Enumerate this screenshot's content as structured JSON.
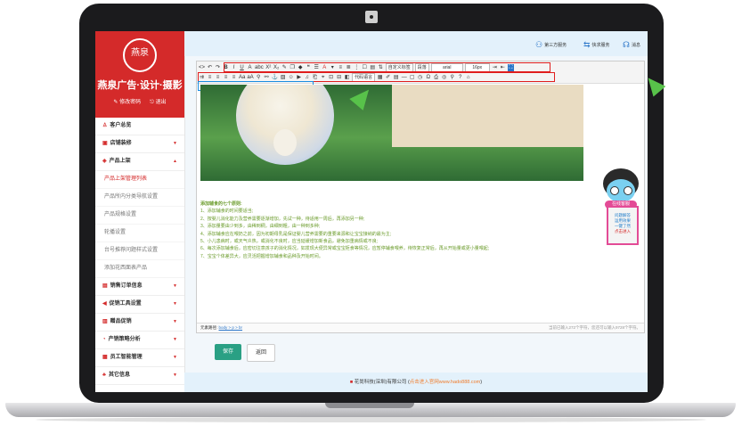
{
  "sidebar": {
    "logo": "燕泉",
    "brand": "燕泉广告·设计·摄影",
    "links": {
      "edit_password": "修改密码",
      "logout": "退出"
    },
    "sections": [
      {
        "label": "客户总览",
        "icon": "user-icon"
      },
      {
        "label": "店铺装修",
        "icon": "shop-icon"
      },
      {
        "label": "产品上架",
        "icon": "product-icon"
      }
    ],
    "product_subs": [
      "产品上架管理列表",
      "产品所内分类导航设置",
      "产品规格设置",
      "轮播设置",
      "台号推荐问题样式设置",
      "添加花西面表产品"
    ],
    "more_sections": [
      {
        "label": "销售订单信息",
        "icon": "order-icon"
      },
      {
        "label": "促销工具设置",
        "icon": "promo-icon"
      },
      {
        "label": "赠品促销",
        "icon": "gift-icon"
      },
      {
        "label": "产销策略分析",
        "icon": "analysis-icon"
      },
      {
        "label": "员工智能管理",
        "icon": "staff-icon"
      },
      {
        "label": "其它信息",
        "icon": "other-icon"
      }
    ]
  },
  "topbar": {
    "third_party": "第三方服务",
    "quick_actions": "快求服务",
    "messages": "消息"
  },
  "editor": {
    "toolbar_row1": [
      "B",
      "I",
      "U",
      "A",
      "abc",
      "X²",
      "X₂",
      "✎",
      "❐",
      "◆",
      "❝",
      "☰",
      "A",
      "▾",
      "≡",
      "≣",
      "⋮",
      "☐",
      "▤",
      "⇅",
      "⌘"
    ],
    "font_family_select": "自定义标签",
    "paragraph_select": "段落",
    "font_select": "arial",
    "size_select": "16px",
    "toolbar_row2_select": "代码语言",
    "notes_title": "添加辅食的七个原则:",
    "notes": [
      "1、添加辅食的时间要适当;",
      "2、按婴儿消化能力及营养需要逐渐增加，先试一种，待适用一周后，再添加另一种;",
      "3、添加量要由少到多，由稀到稠，由细到粗，由一种到多种;",
      "4、添加辅食应在喂奶之前，因为初期母乳是保证婴儿营养需要的重要来源和让宝宝接纳的最为主;",
      "5、小儿患病时，或天气炎热，或消化不良时，应当延缓增加新食品，避免加重病情或不良;",
      "6、每次添加辅食后，应密切注意孩子的消化情况，如发现大便异常或宝宝拒食等情况，应暂停辅食喂养，待恢复正常后，再从开始量或更小量喂起;",
      "7、宝宝个体差异大，应灵活把握增加辅食和品种及开始时间。"
    ],
    "status_prefix": "元素路径:",
    "status_path": "body > p > br",
    "status_count": "当前已输入272个字符，您还可以输入9728个字符。"
  },
  "buttons": {
    "save": "保存",
    "back": "返回"
  },
  "footer": {
    "company": "花尚科技(深圳)有限公司 (",
    "link": "点击进入官网www.hado888.com",
    "close": ")"
  },
  "mascot": {
    "tag": "在线客服",
    "lines": [
      "问题解答",
      "运用效果",
      "一键了然",
      "点击进入"
    ]
  }
}
